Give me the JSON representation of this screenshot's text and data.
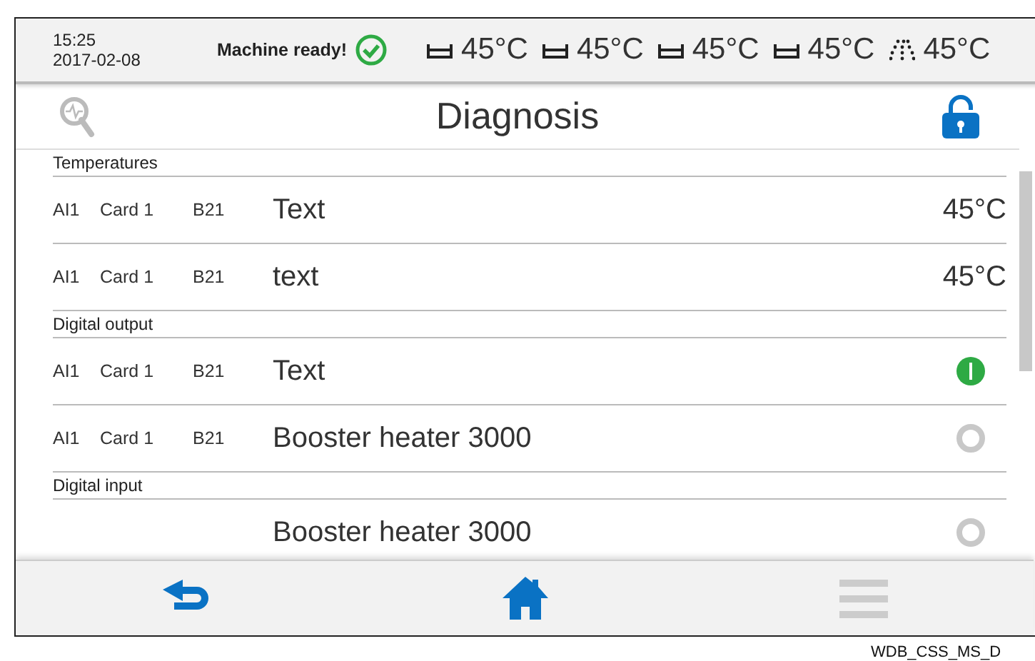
{
  "status_bar": {
    "time": "15:25",
    "date": "2017-02-08",
    "status": "Machine ready!",
    "ready": true,
    "temperatures": [
      {
        "kind": "tank",
        "value": "45°C"
      },
      {
        "kind": "tank",
        "value": "45°C"
      },
      {
        "kind": "tank",
        "value": "45°C"
      },
      {
        "kind": "tank",
        "value": "45°C"
      },
      {
        "kind": "spray",
        "value": "45°C"
      }
    ]
  },
  "header": {
    "title": "Diagnosis",
    "locked": false
  },
  "sections": [
    {
      "title": "Temperatures",
      "rows": [
        {
          "kind": "temperature",
          "input": "AI1",
          "card": "Card 1",
          "sensor": "B21",
          "name": "Text",
          "value": "45°C"
        },
        {
          "kind": "temperature",
          "input": "AI1",
          "card": "Card 1",
          "sensor": "B21",
          "name": "text",
          "value": "45°C"
        }
      ]
    },
    {
      "title": "Digital output",
      "rows": [
        {
          "kind": "digital",
          "input": "AI1",
          "card": "Card 1",
          "sensor": "B21",
          "name": "Text",
          "on": true
        },
        {
          "kind": "digital",
          "input": "AI1",
          "card": "Card 1",
          "sensor": "B21",
          "name": "Booster heater 3000",
          "on": false
        }
      ]
    },
    {
      "title": "Digital input",
      "rows": [
        {
          "kind": "digital",
          "name": "Booster heater 3000",
          "on": false
        }
      ]
    }
  ],
  "caption": "WDB_CSS_MS_D"
}
